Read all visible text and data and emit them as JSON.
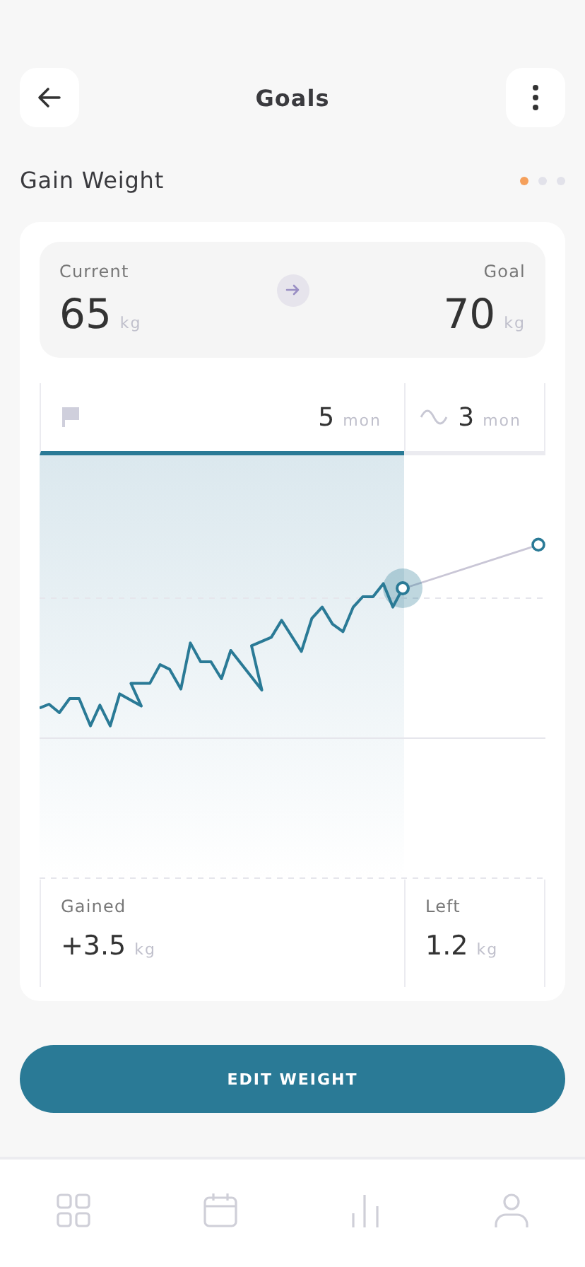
{
  "header": {
    "title": "Goals"
  },
  "goal": {
    "title": "Gain Weight",
    "pages": [
      {
        "selected": true
      },
      {
        "selected": false
      },
      {
        "selected": false
      }
    ]
  },
  "summary": {
    "current_label": "Current",
    "current_value": "65",
    "current_unit": "kg",
    "goal_label": "Goal",
    "goal_value": "70",
    "goal_unit": "kg"
  },
  "periods": [
    {
      "kind": "flag",
      "value": "5",
      "unit": "mon",
      "selected": true
    },
    {
      "kind": "wave",
      "value": "3",
      "unit": "mon",
      "selected": false
    }
  ],
  "stats": [
    {
      "label": "Gained",
      "value": "+3.5",
      "unit": "kg"
    },
    {
      "label": "Left",
      "value": "1.2",
      "unit": "kg"
    }
  ],
  "button": "EDIT WEIGHT",
  "nav": [
    {
      "kind": "grid"
    },
    {
      "kind": "calendar"
    },
    {
      "kind": "chart"
    },
    {
      "kind": "profile"
    }
  ]
}
